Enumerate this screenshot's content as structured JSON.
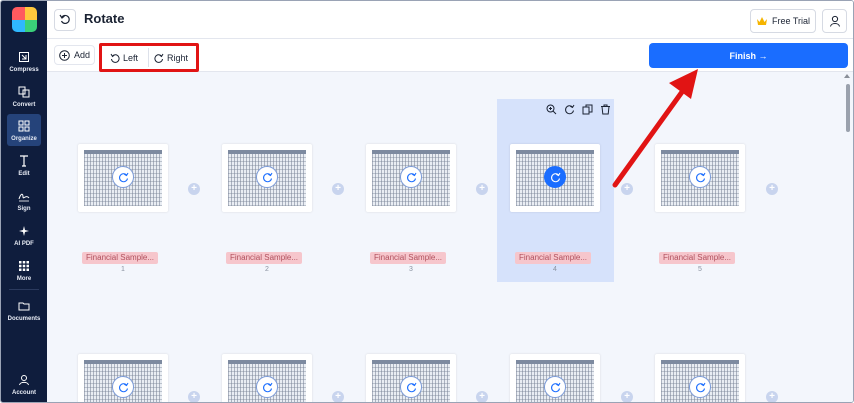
{
  "app": {
    "nav": [
      {
        "label": "Compress",
        "icon": "compress-icon"
      },
      {
        "label": "Convert",
        "icon": "convert-icon"
      },
      {
        "label": "Organize",
        "icon": "organize-icon"
      },
      {
        "label": "Edit",
        "icon": "edit-icon"
      },
      {
        "label": "Sign",
        "icon": "sign-icon"
      },
      {
        "label": "AI PDF",
        "icon": "ai-pdf-icon"
      },
      {
        "label": "More",
        "icon": "more-icon"
      },
      {
        "label": "Documents",
        "icon": "folder-icon"
      },
      {
        "label": "Account",
        "icon": "account-icon"
      }
    ],
    "active_nav": "Organize"
  },
  "topbar": {
    "title": "Rotate",
    "trial_label": "Free Trial"
  },
  "toolbar": {
    "add_label": "Add",
    "left_label": "Left",
    "right_label": "Right",
    "finish_label": "Finish →"
  },
  "pages": [
    {
      "file": "Financial Sample...",
      "number": "1"
    },
    {
      "file": "Financial Sample...",
      "number": "2"
    },
    {
      "file": "Financial Sample...",
      "number": "3"
    },
    {
      "file": "Financial Sample...",
      "number": "4"
    },
    {
      "file": "Financial Sample...",
      "number": "5"
    }
  ],
  "selected_page": "4",
  "colors": {
    "sidebar": "#0f1d3d",
    "accent": "#1a6dff",
    "highlight": "#e11414",
    "label_bg": "#f6c6cc"
  }
}
